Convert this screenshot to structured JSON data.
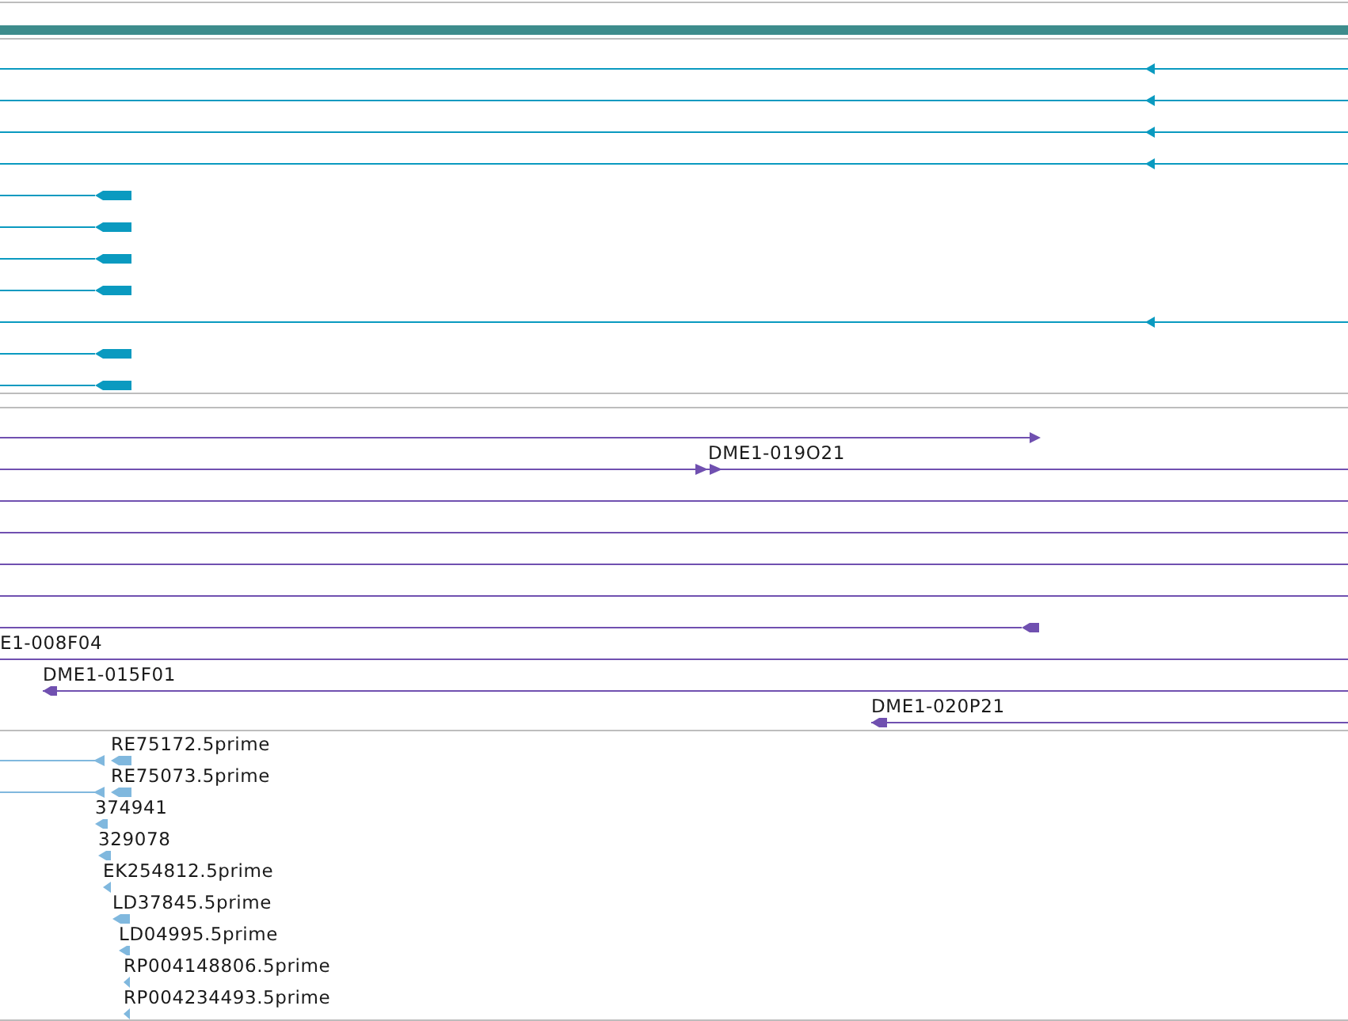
{
  "tracks": [
    {
      "kind": "transcripts",
      "features": [
        {
          "kind": "arrow",
          "reverse": true
        },
        {
          "kind": "arrow",
          "reverse": true
        },
        {
          "kind": "arrow",
          "reverse": true
        },
        {
          "kind": "arrow",
          "reverse": true
        },
        {
          "kind": "arrow",
          "reverse": true
        },
        {
          "kind": "arrow",
          "reverse": true
        },
        {
          "kind": "arrow",
          "reverse": true
        },
        {
          "kind": "arrow",
          "reverse": true
        },
        {
          "kind": "arrow",
          "reverse": true
        },
        {
          "kind": "arrow",
          "reverse": true
        },
        {
          "kind": "arrow",
          "reverse": true
        }
      ]
    },
    {
      "kind": "clones",
      "features": [
        {
          "kind": "arrow",
          "reverse": false
        },
        {
          "kind": "arrow",
          "reverse": false,
          "label": "DME1-019O21"
        },
        {
          "kind": "plain"
        },
        {
          "kind": "plain"
        },
        {
          "kind": "plain"
        },
        {
          "kind": "plain"
        },
        {
          "kind": "arrow",
          "reverse": true
        },
        {
          "kind": "plain",
          "label": "E1-008F04"
        },
        {
          "kind": "arrow",
          "reverse": true,
          "label": "DME1-015F01"
        },
        {
          "kind": "arrow",
          "reverse": true,
          "label": "DME1-020P21"
        }
      ]
    },
    {
      "kind": "ests",
      "features": [
        {
          "kind": "arrow",
          "reverse": true,
          "label": "RE75172.5prime"
        },
        {
          "kind": "arrow",
          "reverse": true,
          "label": "RE75073.5prime"
        },
        {
          "kind": "arrow",
          "reverse": true,
          "label": "374941"
        },
        {
          "kind": "arrow",
          "reverse": true,
          "label": "329078"
        },
        {
          "kind": "arrow",
          "reverse": true,
          "label": "EK254812.5prime"
        },
        {
          "kind": "arrow",
          "reverse": true,
          "label": "LD37845.5prime"
        },
        {
          "kind": "arrow",
          "reverse": true,
          "label": "LD04995.5prime"
        },
        {
          "kind": "arrow",
          "reverse": true,
          "label": "RP004148806.5prime"
        },
        {
          "kind": "arrow",
          "reverse": true,
          "label": "RP004234493.5prime"
        }
      ]
    }
  ]
}
